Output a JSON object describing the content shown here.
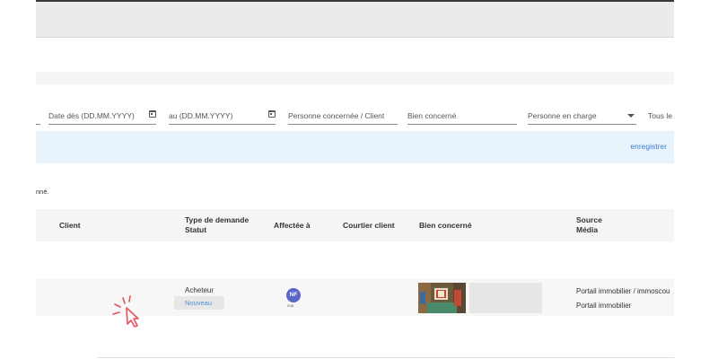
{
  "filters": {
    "date_from": "Date dès (DD.MM.YYYY)",
    "date_to": "au (DD.MM.YYYY)",
    "person": "Personne concernée / Client",
    "property": "Bien concerné",
    "assignee": "Personne en charge",
    "all": "Tous le"
  },
  "save_label": "enregistrer",
  "results_note": "nné.",
  "table": {
    "columns": {
      "client": "Client",
      "type_line1": "Type de demande",
      "type_line2": "Statut",
      "assigned": "Affectée à",
      "broker": "Courtier client",
      "property": "Bien concerné",
      "source_line1": "Source",
      "source_line2": "Média"
    },
    "rows": [
      {
        "type": "Acheteur",
        "status": "Nouveau",
        "assignee_initials": "NF",
        "assignee_sub": "cou",
        "source": "Portail immobilier / immoscou",
        "media": "Portail immobilier"
      }
    ]
  },
  "colors": {
    "accent": "#3b7ec9",
    "save_bar": "#e9f3fc",
    "avatar": "#5a67c9",
    "click_indicator": "#e8505b"
  },
  "icons": [
    "calendar-icon",
    "chevron-down-icon",
    "click-cursor-icon"
  ]
}
